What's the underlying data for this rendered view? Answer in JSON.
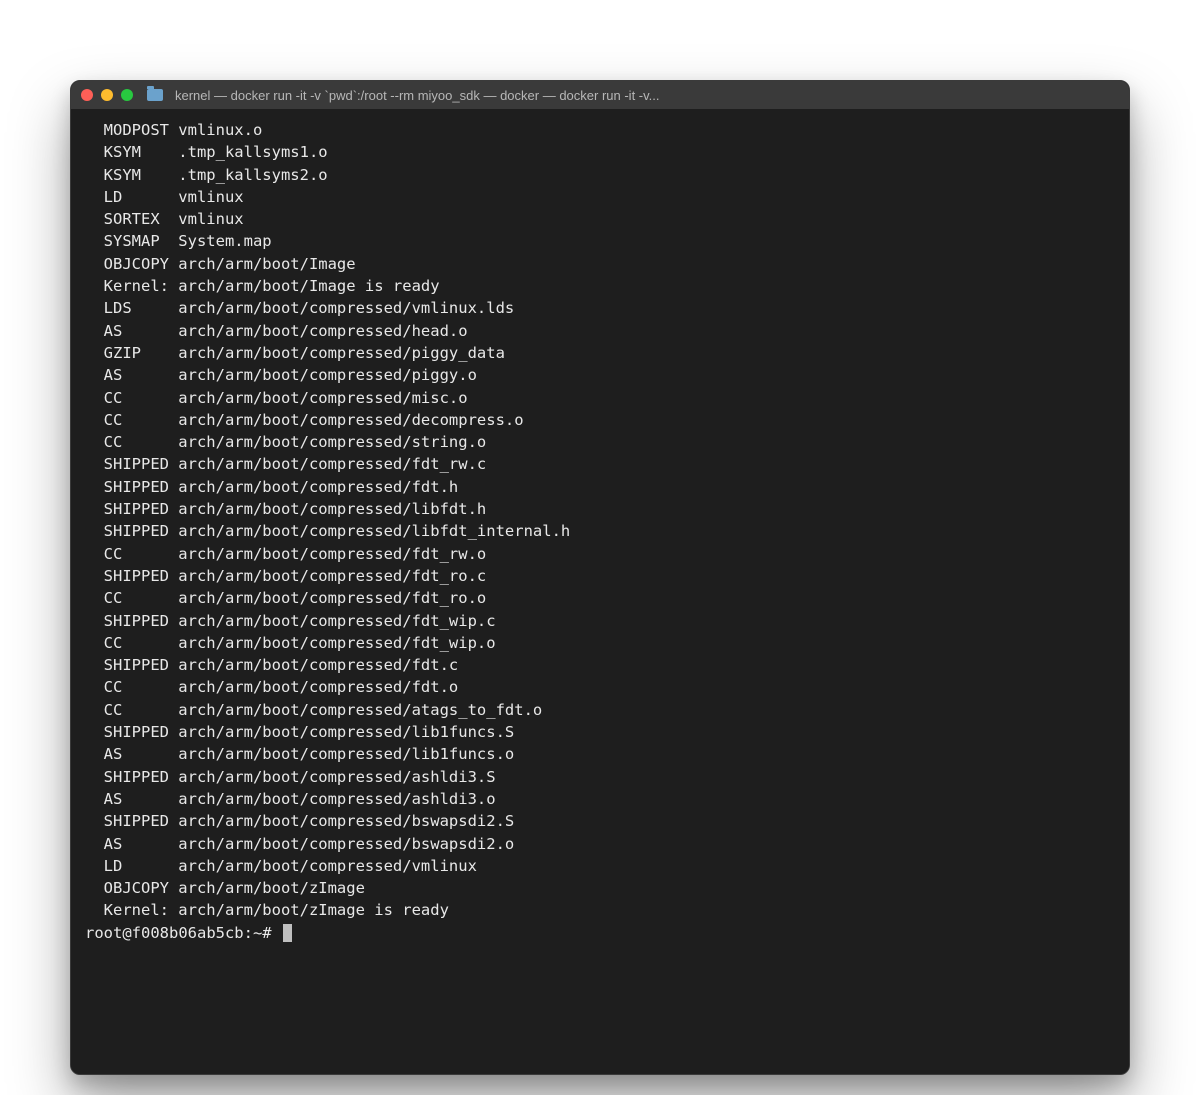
{
  "window": {
    "title": "kernel — docker run -it -v `pwd`:/root --rm miyoo_sdk — docker — docker run -it -v..."
  },
  "icons": {
    "folder": "folder-icon",
    "close": "close-icon",
    "minimize": "minimize-icon",
    "maximize": "maximize-icon"
  },
  "terminal": {
    "lines": [
      {
        "tag": "MODPOST",
        "text": "vmlinux.o"
      },
      {
        "tag": "KSYM",
        "text": ".tmp_kallsyms1.o"
      },
      {
        "tag": "KSYM",
        "text": ".tmp_kallsyms2.o"
      },
      {
        "tag": "LD",
        "text": "vmlinux"
      },
      {
        "tag": "SORTEX",
        "text": "vmlinux"
      },
      {
        "tag": "SYSMAP",
        "text": "System.map"
      },
      {
        "tag": "OBJCOPY",
        "text": "arch/arm/boot/Image"
      },
      {
        "tag": "Kernel:",
        "text": "arch/arm/boot/Image is ready"
      },
      {
        "tag": "LDS",
        "text": "arch/arm/boot/compressed/vmlinux.lds"
      },
      {
        "tag": "AS",
        "text": "arch/arm/boot/compressed/head.o"
      },
      {
        "tag": "GZIP",
        "text": "arch/arm/boot/compressed/piggy_data"
      },
      {
        "tag": "AS",
        "text": "arch/arm/boot/compressed/piggy.o"
      },
      {
        "tag": "CC",
        "text": "arch/arm/boot/compressed/misc.o"
      },
      {
        "tag": "CC",
        "text": "arch/arm/boot/compressed/decompress.o"
      },
      {
        "tag": "CC",
        "text": "arch/arm/boot/compressed/string.o"
      },
      {
        "tag": "SHIPPED",
        "text": "arch/arm/boot/compressed/fdt_rw.c"
      },
      {
        "tag": "SHIPPED",
        "text": "arch/arm/boot/compressed/fdt.h"
      },
      {
        "tag": "SHIPPED",
        "text": "arch/arm/boot/compressed/libfdt.h"
      },
      {
        "tag": "SHIPPED",
        "text": "arch/arm/boot/compressed/libfdt_internal.h"
      },
      {
        "tag": "CC",
        "text": "arch/arm/boot/compressed/fdt_rw.o"
      },
      {
        "tag": "SHIPPED",
        "text": "arch/arm/boot/compressed/fdt_ro.c"
      },
      {
        "tag": "CC",
        "text": "arch/arm/boot/compressed/fdt_ro.o"
      },
      {
        "tag": "SHIPPED",
        "text": "arch/arm/boot/compressed/fdt_wip.c"
      },
      {
        "tag": "CC",
        "text": "arch/arm/boot/compressed/fdt_wip.o"
      },
      {
        "tag": "SHIPPED",
        "text": "arch/arm/boot/compressed/fdt.c"
      },
      {
        "tag": "CC",
        "text": "arch/arm/boot/compressed/fdt.o"
      },
      {
        "tag": "CC",
        "text": "arch/arm/boot/compressed/atags_to_fdt.o"
      },
      {
        "tag": "SHIPPED",
        "text": "arch/arm/boot/compressed/lib1funcs.S"
      },
      {
        "tag": "AS",
        "text": "arch/arm/boot/compressed/lib1funcs.o"
      },
      {
        "tag": "SHIPPED",
        "text": "arch/arm/boot/compressed/ashldi3.S"
      },
      {
        "tag": "AS",
        "text": "arch/arm/boot/compressed/ashldi3.o"
      },
      {
        "tag": "SHIPPED",
        "text": "arch/arm/boot/compressed/bswapsdi2.S"
      },
      {
        "tag": "AS",
        "text": "arch/arm/boot/compressed/bswapsdi2.o"
      },
      {
        "tag": "LD",
        "text": "arch/arm/boot/compressed/vmlinux"
      },
      {
        "tag": "OBJCOPY",
        "text": "arch/arm/boot/zImage"
      },
      {
        "tag": "Kernel:",
        "text": "arch/arm/boot/zImage is ready"
      }
    ],
    "prompt": "root@f008b06ab5cb:~# "
  }
}
